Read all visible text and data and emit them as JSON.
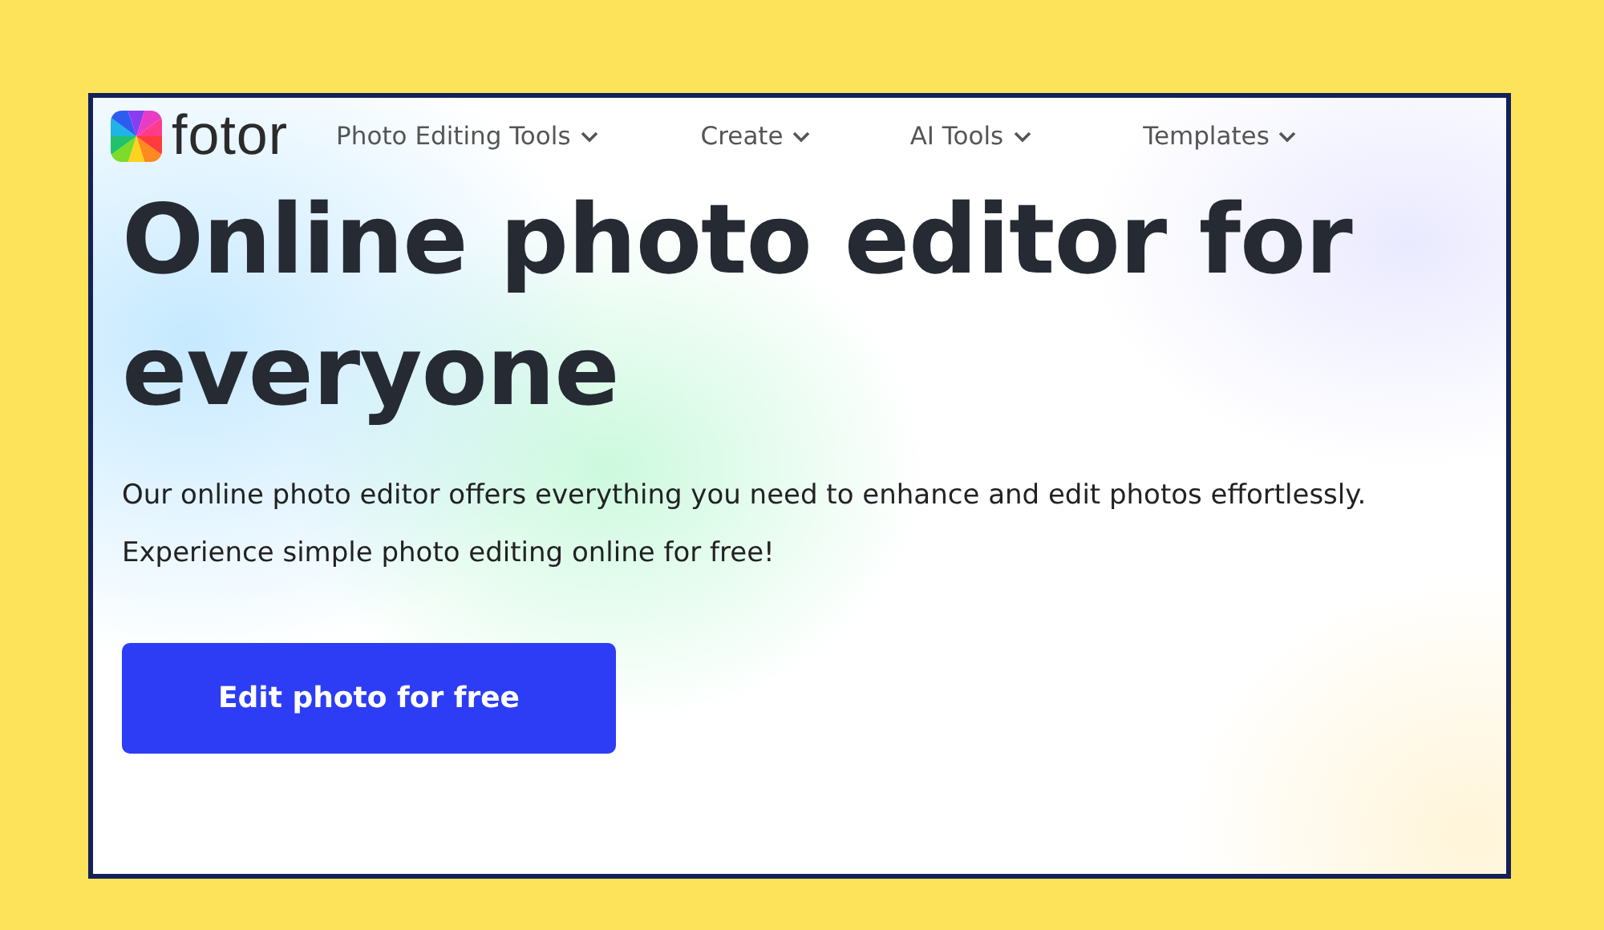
{
  "brand": {
    "name": "fotor"
  },
  "nav": [
    {
      "label": "Photo Editing Tools",
      "dropdown": true
    },
    {
      "label": "Create",
      "dropdown": true
    },
    {
      "label": "AI Tools",
      "dropdown": true
    },
    {
      "label": "Templates",
      "dropdown": true
    }
  ],
  "hero": {
    "heading": "Online photo editor for everyone",
    "description": "Our online photo editor offers everything you need to enhance and edit photos effortlessly. Experience simple photo editing online for free!",
    "cta": "Edit photo for free"
  }
}
